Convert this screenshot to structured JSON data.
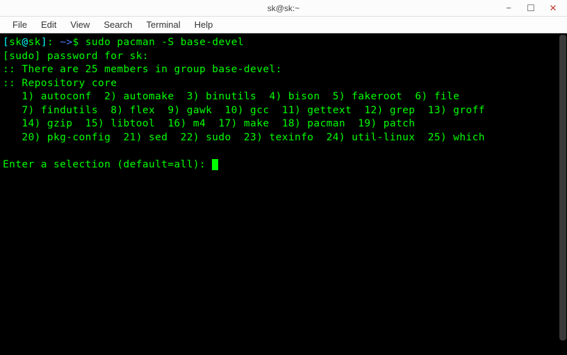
{
  "window": {
    "title": "sk@sk:~",
    "controls": {
      "minimize": "−",
      "maximize": "☐",
      "close": "✕"
    }
  },
  "menubar": {
    "items": [
      "File",
      "Edit",
      "View",
      "Search",
      "Terminal",
      "Help"
    ]
  },
  "terminal": {
    "prompt": {
      "lb": "[",
      "user": "sk",
      "at": "@",
      "host": "sk",
      "rb": "]",
      "colon": ": ",
      "path": "~",
      "arrow": ">",
      "dollar": "$ "
    },
    "command": "sudo pacman -S base-devel",
    "password_line": "[sudo] password for sk: ",
    "members_line": ":: There are 25 members in group base-devel:",
    "repo_line": ":: Repository core",
    "packages_rows": [
      "   1) autoconf  2) automake  3) binutils  4) bison  5) fakeroot  6) file",
      "   7) findutils  8) flex  9) gawk  10) gcc  11) gettext  12) grep  13) groff",
      "   14) gzip  15) libtool  16) m4  17) make  18) pacman  19) patch",
      "   20) pkg-config  21) sed  22) sudo  23) texinfo  24) util-linux  25) which"
    ],
    "blank": "",
    "selection_prompt": "Enter a selection (default=all): "
  }
}
